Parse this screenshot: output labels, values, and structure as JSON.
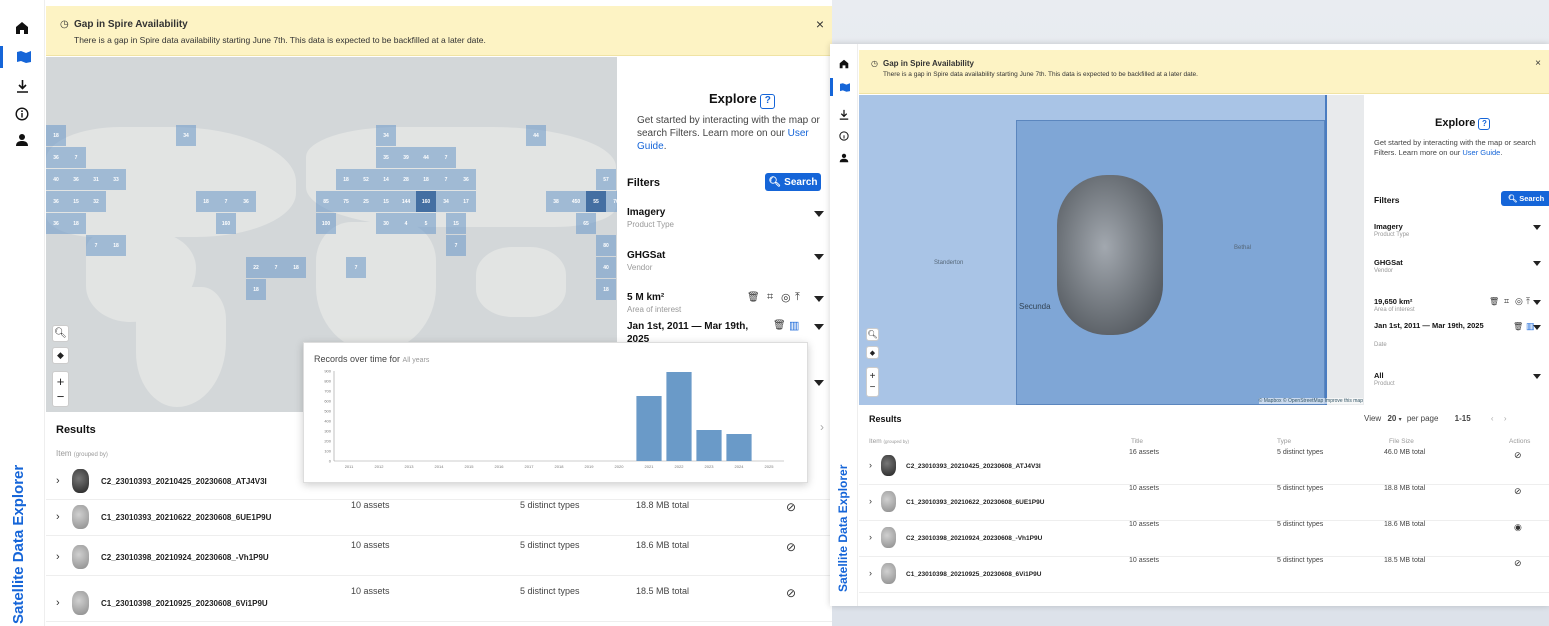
{
  "app_name": "Satellite Data Explorer",
  "banner": {
    "title": "Gap in Spire Availability",
    "message": "There is a gap in Spire data availability starting June 7th. This data is expected to be backfilled at a later date.",
    "close": "×"
  },
  "explore": {
    "title": "Explore",
    "help": "?",
    "intro": "Get started by interacting with the map or search Filters. Learn more on our",
    "link": "User Guide",
    "link_end": "."
  },
  "filters": {
    "title": "Filters",
    "search_label": "Search"
  },
  "left": {
    "imagery": {
      "value": "Imagery",
      "label": "Product Type"
    },
    "vendor": {
      "value": "GHGSat",
      "label": "Vendor"
    },
    "aoi": {
      "value": "5 M km²",
      "label": "Area of interest"
    },
    "date": {
      "value": "Jan 1st, 2011 — Mar 19th, 2025"
    },
    "tiles": [
      "18",
      "34",
      "34",
      "44",
      "36",
      "7",
      "35",
      "39",
      "44",
      "7",
      "40",
      "36",
      "31",
      "33",
      "18",
      "52",
      "14",
      "28",
      "18",
      "7",
      "36",
      "57",
      "36",
      "15",
      "32",
      "18",
      "7",
      "36",
      "85",
      "75",
      "25",
      "15",
      "144",
      "160",
      "34",
      "17",
      "38",
      "450",
      "55",
      "70",
      "36",
      "18",
      "160",
      "100",
      "30",
      "4",
      "5",
      "15",
      "65",
      "7",
      "18",
      "7",
      "80",
      "22",
      "7",
      "18",
      "7",
      "40",
      "18"
    ],
    "chart": {
      "title_prefix": "Records over time for",
      "title_sel": "All years",
      "years": [
        "2011",
        "2012",
        "2013",
        "2014",
        "2015",
        "2016",
        "2017",
        "2018",
        "2019",
        "2020",
        "2021",
        "2022",
        "2023",
        "2024",
        "2025"
      ],
      "values": [
        0,
        0,
        0,
        0,
        0,
        0,
        0,
        0,
        0,
        0,
        650,
        890,
        310,
        270,
        0
      ],
      "yticks": [
        "900",
        "800",
        "700",
        "600",
        "500",
        "400",
        "300",
        "200",
        "100",
        "0"
      ]
    },
    "results_title": "Results",
    "col_item": "Item",
    "col_grouped": "(grouped by)",
    "rows": [
      {
        "name": "C2_23010393_20210425_20230608_ATJ4V3I",
        "assets": "",
        "types": "",
        "size": ""
      },
      {
        "name": "C1_23010393_20210622_20230608_6UE1P9U",
        "assets": "10 assets",
        "types": "5 distinct types",
        "size": "18.8 MB total"
      },
      {
        "name": "C2_23010398_20210924_20230608_-Vh1P9U",
        "assets": "10 assets",
        "types": "5 distinct types",
        "size": "18.6 MB total"
      },
      {
        "name": "C1_23010398_20210925_20230608_6Vi1P9U",
        "assets": "10 assets",
        "types": "5 distinct types",
        "size": "18.5 MB total"
      }
    ]
  },
  "right": {
    "imagery": {
      "value": "Imagery",
      "label": "Product Type"
    },
    "vendor": {
      "value": "GHGSat",
      "label": "Vendor"
    },
    "aoi": {
      "value": "19,650 km²",
      "label": "Area of interest"
    },
    "date": {
      "value": "Jan 1st, 2011 — Mar 19th, 2025",
      "label": "Date"
    },
    "product": {
      "value": "All",
      "label": "Product"
    },
    "places": {
      "a": "Secunda",
      "b": "Bethal",
      "c": "Standerton"
    },
    "attribution": "© Mapbox © OpenStreetMap Improve this map",
    "results_title": "Results",
    "view_label": "View",
    "per_page_value": "20",
    "per_page_label": "per page",
    "range": "1-15",
    "cols": {
      "item": "Item",
      "grouped": "(grouped by)",
      "title": "Title",
      "type": "Type",
      "size": "File Size",
      "actions": "Actions"
    },
    "rows": [
      {
        "name": "C2_23010393_20210425_20230608_ATJ4V3I",
        "assets": "16 assets",
        "types": "5 distinct types",
        "size": "46.0 MB total"
      },
      {
        "name": "C1_23010393_20210622_20230608_6UE1P9U",
        "assets": "10 assets",
        "types": "5 distinct types",
        "size": "18.8 MB total"
      },
      {
        "name": "C2_23010398_20210924_20230608_-Vh1P9U",
        "assets": "10 assets",
        "types": "5 distinct types",
        "size": "18.6 MB total"
      },
      {
        "name": "C1_23010398_20210925_20230608_6Vi1P9U",
        "assets": "10 assets",
        "types": "5 distinct types",
        "size": "18.5 MB total"
      }
    ]
  },
  "colors": {
    "accent": "#1565d8",
    "banner": "#fdf3c4",
    "tile": "#6997c8"
  }
}
